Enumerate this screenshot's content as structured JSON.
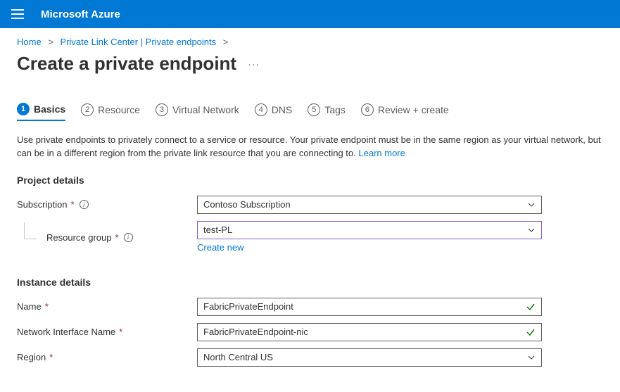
{
  "header": {
    "brand": "Microsoft Azure"
  },
  "breadcrumb": {
    "home": "Home",
    "link_center": "Private Link Center | Private endpoints"
  },
  "page": {
    "title": "Create a private endpoint",
    "ellipsis": "···"
  },
  "tabs": [
    {
      "num": "1",
      "label": "Basics"
    },
    {
      "num": "2",
      "label": "Resource"
    },
    {
      "num": "3",
      "label": "Virtual Network"
    },
    {
      "num": "4",
      "label": "DNS"
    },
    {
      "num": "5",
      "label": "Tags"
    },
    {
      "num": "6",
      "label": "Review + create"
    }
  ],
  "intro": {
    "text": "Use private endpoints to privately connect to a service or resource. Your private endpoint must be in the same region as your virtual network, but can be in a different region from the private link resource that you are connecting to.  ",
    "learn_more": "Learn more"
  },
  "project": {
    "heading": "Project details",
    "subscription_label": "Subscription",
    "subscription_value": "Contoso Subscription",
    "rg_label": "Resource group",
    "rg_value": "test-PL",
    "create_new": "Create new"
  },
  "instance": {
    "heading": "Instance details",
    "name_label": "Name",
    "name_value": "FabricPrivateEndpoint",
    "nic_label": "Network Interface Name",
    "nic_value": "FabricPrivateEndpoint-nic",
    "region_label": "Region",
    "region_value": "North Central US"
  }
}
